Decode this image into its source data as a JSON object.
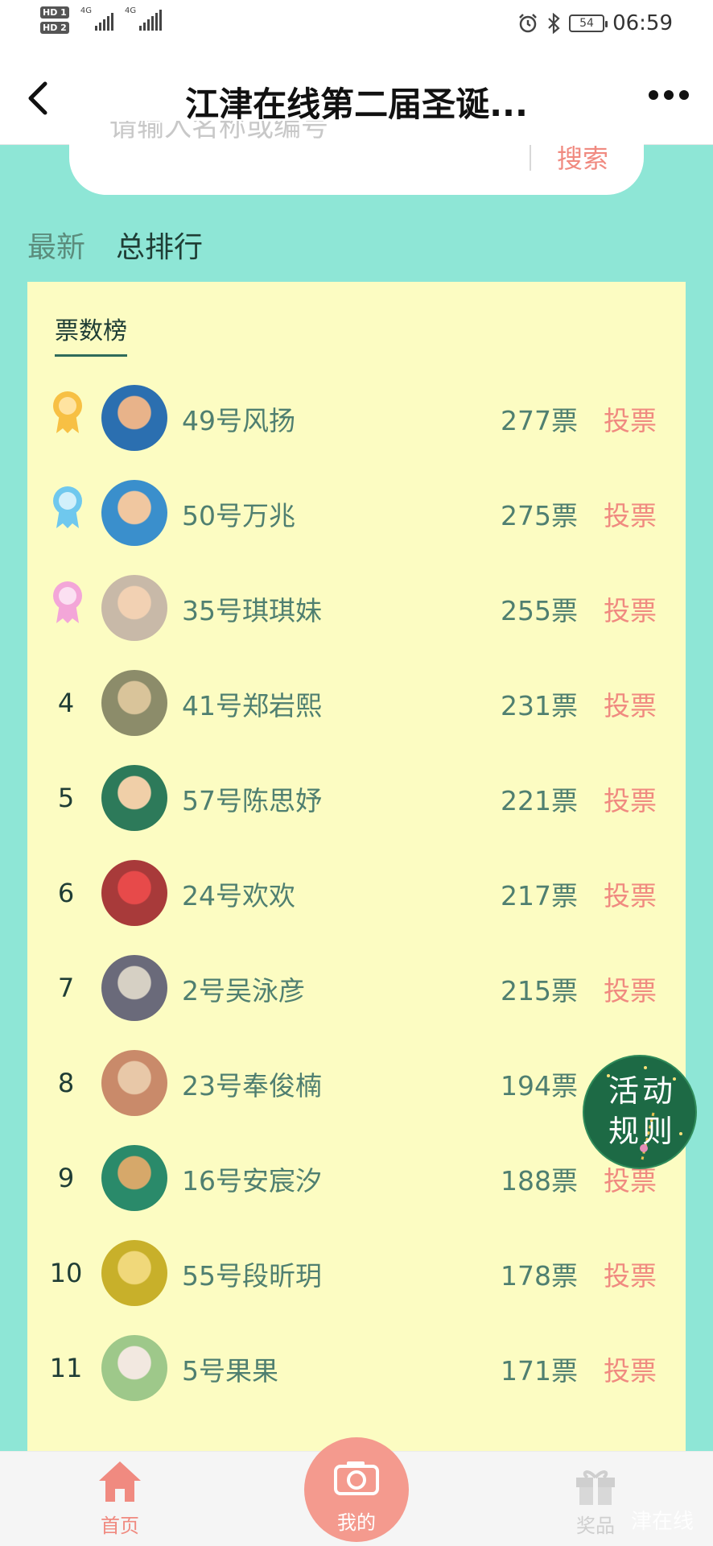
{
  "status_bar": {
    "hd1": "HD 1",
    "hd2": "HD 2",
    "net1": "4G",
    "net2": "4G",
    "battery": "54",
    "time": "06:59",
    "icons": [
      "alarm-icon",
      "bluetooth-icon",
      "battery-icon",
      "signal-icon"
    ]
  },
  "nav": {
    "title": "江津在线第二届圣诞...",
    "back_icon": "back-chevron-icon",
    "more_icon": "more-dots-icon"
  },
  "search": {
    "placeholder": "请输入名称或编号",
    "button": "搜索"
  },
  "tabs": [
    {
      "label": "最新",
      "active": false
    },
    {
      "label": "总排行",
      "active": true
    }
  ],
  "leaderboard": {
    "title": "票数榜",
    "vote_label": "投票",
    "rows": [
      {
        "rank": "1",
        "medal": "gold",
        "name": "49号风扬",
        "votes": "277票"
      },
      {
        "rank": "2",
        "medal": "blue",
        "name": "50号万兆",
        "votes": "275票"
      },
      {
        "rank": "3",
        "medal": "pink",
        "name": "35号琪琪妹",
        "votes": "255票"
      },
      {
        "rank": "4",
        "medal": "",
        "name": "41号郑岩熙",
        "votes": "231票"
      },
      {
        "rank": "5",
        "medal": "",
        "name": "57号陈思妤",
        "votes": "221票"
      },
      {
        "rank": "6",
        "medal": "",
        "name": "24号欢欢",
        "votes": "217票"
      },
      {
        "rank": "7",
        "medal": "",
        "name": "2号吴泳彦",
        "votes": "215票"
      },
      {
        "rank": "8",
        "medal": "",
        "name": "23号奉俊楠",
        "votes": "194票"
      },
      {
        "rank": "9",
        "medal": "",
        "name": "16号安宸汐",
        "votes": "188票"
      },
      {
        "rank": "10",
        "medal": "",
        "name": "55号段昕玥",
        "votes": "178票"
      },
      {
        "rank": "11",
        "medal": "",
        "name": "5号果果",
        "votes": "171票"
      }
    ]
  },
  "rules_button": {
    "label": "活动规则"
  },
  "bottom_nav": {
    "home": "首页",
    "mine": "我的",
    "gift": "奖品",
    "watermark": "津在线"
  },
  "colors": {
    "background": "#8ee6d6",
    "panel": "#fcfcc2",
    "accent": "#f08a80",
    "text_green": "#4f7f70",
    "rules_green": "#1d6a45"
  }
}
